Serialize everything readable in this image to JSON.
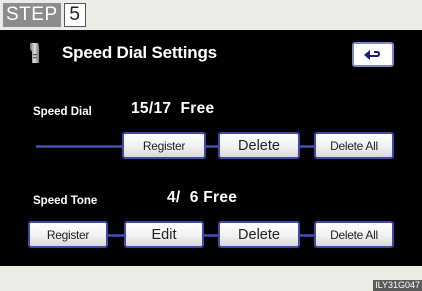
{
  "step": {
    "label": "STEP",
    "number": "5"
  },
  "screen": {
    "title": "Speed Dial Settings",
    "back_icon": "back-arrow-icon",
    "phone_icon": "phone-handset-icon"
  },
  "speed_dial": {
    "label": "Speed Dial",
    "free_text": "15/17  Free",
    "buttons": {
      "register": "Register",
      "delete": "Delete",
      "delete_all": "Delete All"
    }
  },
  "speed_tone": {
    "label": "Speed Tone",
    "free_text": "4/  6 Free",
    "buttons": {
      "register": "Register",
      "edit": "Edit",
      "delete": "Delete",
      "delete_all": "Delete All"
    }
  },
  "image_code": "ILY31G047",
  "colors": {
    "screen_background": "#000000",
    "button_border": "#3e4aa6",
    "connector_line": "#4c5cc6",
    "page_background": "#ecebe6"
  }
}
